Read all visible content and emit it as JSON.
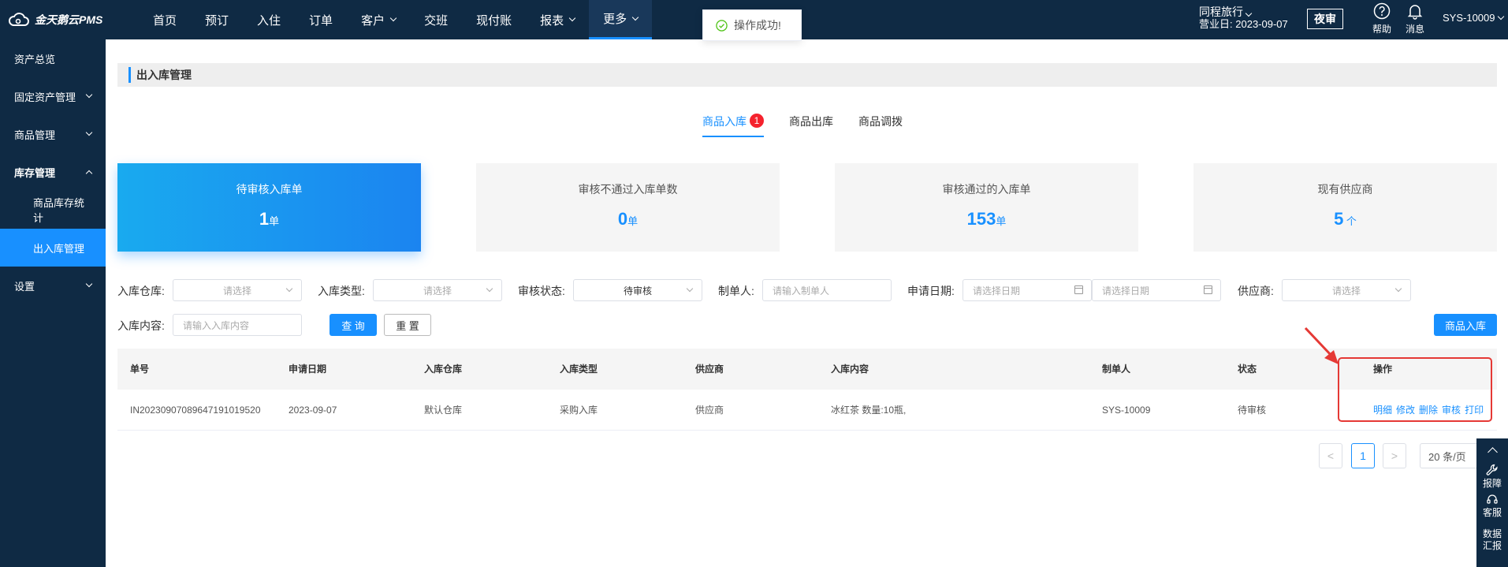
{
  "brand": {
    "logo_text": "金天鹅云PMS",
    "logo_icon": "cloud-logo-icon"
  },
  "nav": {
    "items": [
      {
        "label": "首页",
        "has_caret": false,
        "active": false
      },
      {
        "label": "预订",
        "has_caret": false,
        "active": false
      },
      {
        "label": "入住",
        "has_caret": false,
        "active": false
      },
      {
        "label": "订单",
        "has_caret": false,
        "active": false
      },
      {
        "label": "客户",
        "has_caret": true,
        "active": false
      },
      {
        "label": "交班",
        "has_caret": false,
        "active": false
      },
      {
        "label": "现付账",
        "has_caret": false,
        "active": false
      },
      {
        "label": "报表",
        "has_caret": true,
        "active": false
      },
      {
        "label": "更多",
        "has_caret": true,
        "active": true
      }
    ]
  },
  "header": {
    "hotel_name": "同程旅行",
    "business_day_label": "营业日:",
    "business_day": "2023-09-07",
    "night_audit_label": "夜审",
    "help_label": "帮助",
    "message_label": "消息",
    "user": "SYS-10009"
  },
  "toast": {
    "message": "操作成功!",
    "icon": "check-circle-icon",
    "color": "#52c41a"
  },
  "sidebar": {
    "items": [
      {
        "label": "资产总览",
        "type": "top",
        "expand": "none"
      },
      {
        "label": "固定资产管理",
        "type": "top",
        "expand": "down"
      },
      {
        "label": "商品管理",
        "type": "top",
        "expand": "down"
      },
      {
        "label": "库存管理",
        "type": "top",
        "expand": "up",
        "bold": true
      },
      {
        "label": "商品库存统计",
        "type": "sub",
        "expand": "none"
      },
      {
        "label": "出入库管理",
        "type": "sub",
        "expand": "none",
        "active": true
      },
      {
        "label": "设置",
        "type": "top",
        "expand": "down"
      }
    ]
  },
  "page": {
    "title": "出入库管理"
  },
  "tabs": [
    {
      "label": "商品入库",
      "badge": "1",
      "active": true
    },
    {
      "label": "商品出库",
      "badge": "",
      "active": false
    },
    {
      "label": "商品调拨",
      "badge": "",
      "active": false
    }
  ],
  "stats": [
    {
      "title": "待审核入库单",
      "value": "1",
      "unit": "单",
      "primary": true
    },
    {
      "title": "审核不通过入库单数",
      "value": "0",
      "unit": "单",
      "primary": false
    },
    {
      "title": "审核通过的入库单",
      "value": "153",
      "unit": "单",
      "primary": false
    },
    {
      "title": "现有供应商",
      "value": "5",
      "unit": " 个",
      "primary": false
    }
  ],
  "filters": {
    "warehouse": {
      "label": "入库仓库:",
      "placeholder": "请选择"
    },
    "type": {
      "label": "入库类型:",
      "placeholder": "请选择"
    },
    "audit_status": {
      "label": "审核状态:",
      "value": "待审核"
    },
    "creator": {
      "label": "制单人:",
      "placeholder": "请输入制单人"
    },
    "apply_date": {
      "label": "申请日期:",
      "start_placeholder": "请选择日期",
      "end_placeholder": "请选择日期"
    },
    "supplier": {
      "label": "供应商:",
      "placeholder": "请选择"
    },
    "content": {
      "label": "入库内容:",
      "placeholder": "请输入入库内容"
    },
    "query_label": "查 询",
    "reset_label": "重 置",
    "add_label": "商品入库"
  },
  "table": {
    "columns": [
      "单号",
      "申请日期",
      "入库仓库",
      "入库类型",
      "供应商",
      "入库内容",
      "制单人",
      "状态",
      "操作"
    ],
    "rows": [
      {
        "order_no": "IN20230907089647191019520",
        "apply_date": "2023-09-07",
        "warehouse": "默认仓库",
        "type": "采购入库",
        "supplier": "供应商",
        "content": "冰红茶 数量:10瓶,",
        "creator": "SYS-10009",
        "status": "待审核",
        "actions": [
          "明细",
          "修改",
          "删除",
          "审核",
          "打印"
        ]
      }
    ]
  },
  "pagination": {
    "prev": "<",
    "page": "1",
    "next": ">",
    "page_size": "20 条/页"
  },
  "float_bar": {
    "items": [
      "报障",
      "客服",
      "数据汇报"
    ]
  },
  "annotation": {
    "color": "#e53935"
  }
}
